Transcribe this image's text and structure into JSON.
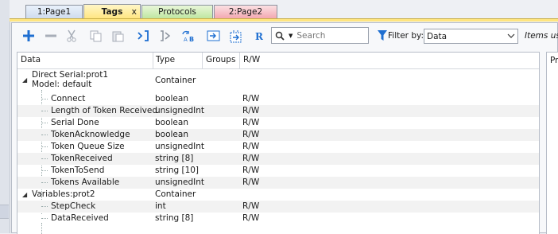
{
  "tabs": [
    {
      "label": "1:Page1",
      "color": "#cfdcee"
    },
    {
      "label": "Tags",
      "color": "#ffe57f",
      "close": "x"
    },
    {
      "label": "Protocols",
      "color": "#bfe6a1"
    },
    {
      "label": "2:Page2",
      "color": "#f3a8b1"
    }
  ],
  "toolbar": {
    "search_placeholder": "Search",
    "filter_label": "Filter by:",
    "filter_value": "Data",
    "items_label": "Items us",
    "icons": [
      "plus-icon",
      "minus-icon",
      "cut-icon",
      "copy-icon",
      "paste-icon",
      "bracket-icon",
      "bracket-outline-icon",
      "sort-ab-icon",
      "tag-import-icon",
      "tag-export-icon",
      "r-icon"
    ]
  },
  "grid": {
    "columns": [
      "Data",
      "Type",
      "Groups",
      "R/W"
    ],
    "rows": [
      {
        "name": "Direct Serial:prot1",
        "name2": "Model: default",
        "type": "Container",
        "rw": ""
      },
      {
        "name": "Connect",
        "type": "boolean",
        "rw": "R/W"
      },
      {
        "name": "Length of Token Received",
        "type": "unsignedInt",
        "rw": "R/W"
      },
      {
        "name": "Serial Done",
        "type": "boolean",
        "rw": "R/W"
      },
      {
        "name": "TokenAcknowledge",
        "type": "boolean",
        "rw": "R/W"
      },
      {
        "name": "Token Queue Size",
        "type": "unsignedInt",
        "rw": "R/W"
      },
      {
        "name": "TokenReceived",
        "type": "string [8]",
        "rw": "R/W"
      },
      {
        "name": "TokenToSend",
        "type": "string [10]",
        "rw": "R/W"
      },
      {
        "name": "Tokens Available",
        "type": "unsignedInt",
        "rw": "R/W"
      },
      {
        "name": "Variables:prot2",
        "type": "Container",
        "rw": ""
      },
      {
        "name": "StepCheck",
        "type": "int",
        "rw": "R/W"
      },
      {
        "name": "DataReceived",
        "type": "string [8]",
        "rw": "R/W"
      }
    ]
  },
  "right_pane": {
    "label": "Pr"
  },
  "colors": {
    "accent_blue": "#1f6fd1",
    "tab_active": "#ffe57f"
  }
}
